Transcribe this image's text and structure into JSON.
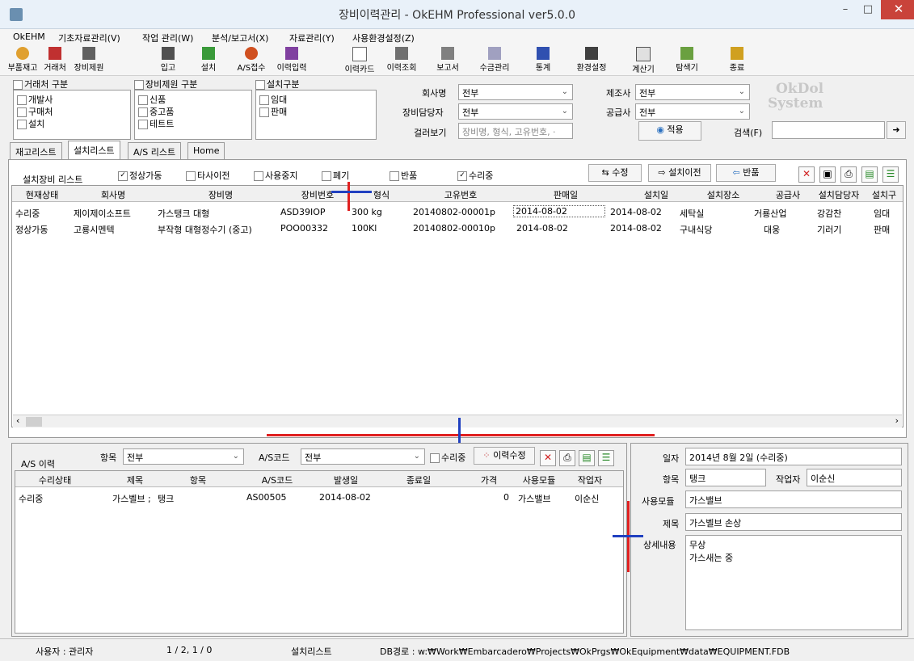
{
  "window": {
    "title": "장비이력관리 - OkEHM Professional ver5.0.0",
    "close_glyph": "✕",
    "min_glyph": "–",
    "max_glyph": "□"
  },
  "menu": [
    "OkEHM",
    "기초자료관리(V)",
    "작업 관리(W)",
    "분석/보고서(X)",
    "자료관리(Y)",
    "사용환경설정(Z)"
  ],
  "toolbar": [
    "부품재고",
    "거래처",
    "장비제원",
    "입고",
    "설치",
    "A/S접수",
    "이력입력",
    "이력카드",
    "이력조회",
    "보고서",
    "수금관리",
    "통계",
    "환경설정",
    "계산기",
    "탐색기",
    "종료"
  ],
  "filters": {
    "vendor_group": {
      "title": "거래처 구분",
      "items": [
        "개발사",
        "구매처",
        "설치"
      ]
    },
    "spec_group": {
      "title": "장비제원 구분",
      "items": [
        "신품",
        "중고품",
        "테트트"
      ]
    },
    "install_group": {
      "title": "설치구분",
      "items": [
        "임대",
        "판매"
      ]
    },
    "company_label": "회사명",
    "company_value": "전부",
    "manager_label": "장비담당자",
    "manager_value": "전부",
    "filter_label": "걸러보기",
    "filter_placeholder": "장비명, 형식, 고유번호, ·",
    "maker_label": "제조사",
    "maker_value": "전부",
    "supplier_label": "공급사",
    "supplier_value": "전부",
    "apply_label": "적용",
    "search_label": "검색(F)",
    "logo_line1": "OkDol",
    "logo_line2": "System"
  },
  "tabs": [
    "재고리스트",
    "설치리스트",
    "A/S 리스트",
    "Home"
  ],
  "install_list": {
    "title": "설치장비 리스트",
    "checks": [
      {
        "label": "정상가동",
        "checked": true
      },
      {
        "label": "타사이전",
        "checked": false
      },
      {
        "label": "사용중지",
        "checked": false
      },
      {
        "label": "폐기",
        "checked": false
      },
      {
        "label": "반품",
        "checked": false
      },
      {
        "label": "수리중",
        "checked": true
      }
    ],
    "buttons": {
      "edit": "수정",
      "move": "설치이전",
      "return": "반품"
    },
    "columns": [
      "현재상태",
      "회사명",
      "장비명",
      "장비번호",
      "형식",
      "고유번호",
      "판매일",
      "설치일",
      "설치장소",
      "공급사",
      "설치담당자",
      "설치구"
    ],
    "rows": [
      [
        "수리중",
        "제이제이소프트",
        "가스탱크 대형",
        "ASD39IOP",
        "300 kg",
        "20140802-00001p",
        "2014-08-02",
        "2014-08-02",
        "세탁실",
        "거룡산업",
        "강감찬",
        "임대"
      ],
      [
        "정상가동",
        "고룡시멘텍",
        "부작형 대형정수기 (중고)",
        "POO00332",
        "100Kl",
        "20140802-00010p",
        "2014-08-02",
        "2014-08-02",
        "구내식당",
        "대웅",
        "기러기",
        "판매"
      ]
    ]
  },
  "as_history": {
    "title": "A/S 이력",
    "item_label": "항목",
    "item_value": "전부",
    "code_label": "A/S코드",
    "code_value": "전부",
    "repair_check": "수리중",
    "edit_button": "이력수정",
    "columns": [
      "수리상태",
      "제목",
      "항목",
      "A/S코드",
      "발생일",
      "종료일",
      "가격",
      "사용모듈",
      "작업자"
    ],
    "rows": [
      [
        "수리중",
        "가스벨브 ;",
        "탱크",
        "AS00505",
        "2014-08-02",
        "",
        "0",
        "가스밸브",
        "이순신"
      ]
    ]
  },
  "detail": {
    "date_label": "일자",
    "date_value": "2014년 8월 2일 (수리중)",
    "item_label": "항목",
    "item_value": "탱크",
    "worker_label": "작업자",
    "worker_value": "이순신",
    "module_label": "사용모듈",
    "module_value": "가스밸브",
    "subject_label": "제목",
    "subject_value": "가스벨브 손상",
    "content_label": "상세내용",
    "content_line1": "무상",
    "content_line2": "가스새는 중"
  },
  "status": {
    "user": "사용자 : 관리자",
    "count": "1 / 2, 1 / 0",
    "view": "설치리스트",
    "db": "DB경로 : w:₩Work₩Embarcadero₩Projects₩OkPrgs₩OkEquipment₩data₩EQUIPMENT.FDB"
  }
}
